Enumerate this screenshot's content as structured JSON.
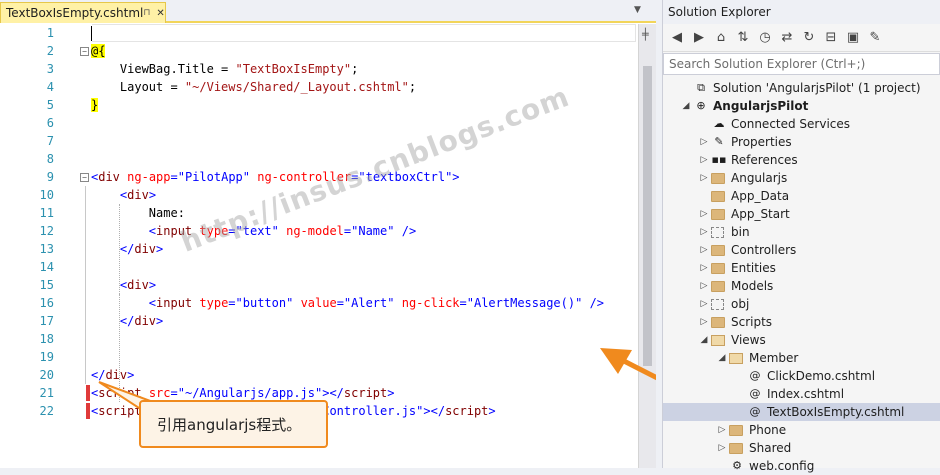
{
  "editor": {
    "tab_title": "TextBoxIsEmpty.cshtml",
    "tab_pin": "⊓",
    "tab_close": "✕",
    "lines": [
      {
        "n": "1",
        "html": ""
      },
      {
        "n": "2",
        "html": "<span class=\"rz\">@{</span>"
      },
      {
        "n": "3",
        "html": "    ViewBag.Title = <span class=\"cs\">\"TextBoxIsEmpty\"</span>;"
      },
      {
        "n": "4",
        "html": "    Layout = <span class=\"cs\">\"~/Views/Shared/_Layout.cshtml\"</span>;"
      },
      {
        "n": "5",
        "html": "<span class=\"rz\">}</span>"
      },
      {
        "n": "6",
        "html": ""
      },
      {
        "n": "7",
        "html": ""
      },
      {
        "n": "8",
        "html": ""
      },
      {
        "n": "9",
        "html": "<span class=\"st\">&lt;</span><span class=\"kw\">div</span> <span class=\"at\">ng-app</span><span class=\"st\">=\"PilotApp\"</span> <span class=\"at\">ng-controller</span><span class=\"st\">=\"textboxCtrl\"&gt;</span>"
      },
      {
        "n": "10",
        "html": "    <span class=\"st\">&lt;</span><span class=\"kw\">div</span><span class=\"st\">&gt;</span>"
      },
      {
        "n": "11",
        "html": "        Name:"
      },
      {
        "n": "12",
        "html": "        <span class=\"st\">&lt;</span><span class=\"kw\">input</span> <span class=\"at\">type</span><span class=\"st\">=\"text\"</span> <span class=\"at\">ng-model</span><span class=\"st\">=\"Name\"</span> <span class=\"st\">/&gt;</span>"
      },
      {
        "n": "13",
        "html": "    <span class=\"st\">&lt;/</span><span class=\"kw\">div</span><span class=\"st\">&gt;</span>"
      },
      {
        "n": "14",
        "html": ""
      },
      {
        "n": "15",
        "html": "    <span class=\"st\">&lt;</span><span class=\"kw\">div</span><span class=\"st\">&gt;</span>"
      },
      {
        "n": "16",
        "html": "        <span class=\"st\">&lt;</span><span class=\"kw\">input</span> <span class=\"at\">type</span><span class=\"st\">=\"button\"</span> <span class=\"at\">value</span><span class=\"st\">=\"Alert\"</span> <span class=\"at\">ng-click</span><span class=\"st\">=\"AlertMessage()\"</span> <span class=\"st\">/&gt;</span>"
      },
      {
        "n": "17",
        "html": "    <span class=\"st\">&lt;/</span><span class=\"kw\">div</span><span class=\"st\">&gt;</span>"
      },
      {
        "n": "18",
        "html": ""
      },
      {
        "n": "19",
        "html": ""
      },
      {
        "n": "20",
        "html": "<span class=\"st\">&lt;/</span><span class=\"kw\">div</span><span class=\"st\">&gt;</span>"
      },
      {
        "n": "21",
        "html": "<span class=\"st\">&lt;</span><span class=\"kw\">script</span> <span class=\"at\">src</span><span class=\"st\">=\"~/Angularjs/app.js\"&gt;&lt;/</span><span class=\"kw\">script</span><span class=\"st\">&gt;</span>"
      },
      {
        "n": "22",
        "html": "<span class=\"st\">&lt;</span><span class=\"kw\">script</span> <span class=\"at\">src</span><span class=\"st\">=\"~/Angularjs/TextboxController.js\"&gt;&lt;/</span><span class=\"kw\">script</span><span class=\"st\">&gt;</span>"
      }
    ]
  },
  "watermark": "http://insus.cnblogs.com",
  "callout": "引用angularjs程式。",
  "solution_explorer": {
    "title": "Solution Explorer",
    "search_placeholder": "Search Solution Explorer (Ctrl+;)",
    "toolbar_icons": [
      "back-icon",
      "forward-icon",
      "home-icon",
      "sync-icon",
      "history-icon",
      "switch-icon",
      "refresh-icon",
      "collapse-icon",
      "show-all-icon",
      "properties-icon"
    ],
    "nodes": [
      {
        "label": "Solution 'AngularjsPilot' (1 project)",
        "depth": 0,
        "exp": "",
        "icon": "solution"
      },
      {
        "label": "AngularjsPilot",
        "depth": 0,
        "exp": "◢",
        "icon": "globe",
        "bold": true
      },
      {
        "label": "Connected Services",
        "depth": 1,
        "exp": "",
        "icon": "cloud"
      },
      {
        "label": "Properties",
        "depth": 1,
        "exp": "▷",
        "icon": "wrench"
      },
      {
        "label": "References",
        "depth": 1,
        "exp": "▷",
        "icon": "refs"
      },
      {
        "label": "Angularjs",
        "depth": 1,
        "exp": "▷",
        "icon": "folder"
      },
      {
        "label": "App_Data",
        "depth": 1,
        "exp": "",
        "icon": "folder"
      },
      {
        "label": "App_Start",
        "depth": 1,
        "exp": "▷",
        "icon": "folder"
      },
      {
        "label": "bin",
        "depth": 1,
        "exp": "▷",
        "icon": "dashfolder"
      },
      {
        "label": "Controllers",
        "depth": 1,
        "exp": "▷",
        "icon": "folder"
      },
      {
        "label": "Entities",
        "depth": 1,
        "exp": "▷",
        "icon": "folder"
      },
      {
        "label": "Models",
        "depth": 1,
        "exp": "▷",
        "icon": "folder"
      },
      {
        "label": "obj",
        "depth": 1,
        "exp": "▷",
        "icon": "dashfolder"
      },
      {
        "label": "Scripts",
        "depth": 1,
        "exp": "▷",
        "icon": "folder"
      },
      {
        "label": "Views",
        "depth": 1,
        "exp": "◢",
        "icon": "folder-open"
      },
      {
        "label": "Member",
        "depth": 2,
        "exp": "◢",
        "icon": "folder-open"
      },
      {
        "label": "ClickDemo.cshtml",
        "depth": 3,
        "exp": "",
        "icon": "razor"
      },
      {
        "label": "Index.cshtml",
        "depth": 3,
        "exp": "",
        "icon": "razor"
      },
      {
        "label": "TextBoxIsEmpty.cshtml",
        "depth": 3,
        "exp": "",
        "icon": "razor",
        "selected": true
      },
      {
        "label": "Phone",
        "depth": 2,
        "exp": "▷",
        "icon": "folder"
      },
      {
        "label": "Shared",
        "depth": 2,
        "exp": "▷",
        "icon": "folder"
      },
      {
        "label": "web.config",
        "depth": 2,
        "exp": "",
        "icon": "config"
      }
    ]
  },
  "colors": {
    "accent": "#f08a1e",
    "tab": "#fff1a6",
    "selection": "#ccd2e3"
  }
}
